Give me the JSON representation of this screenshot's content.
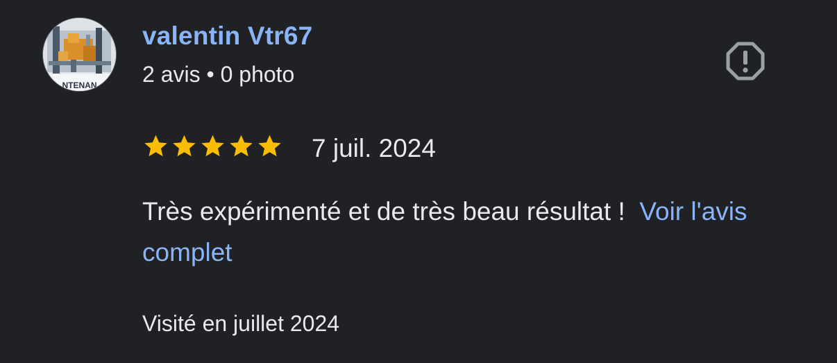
{
  "review": {
    "author": {
      "name": "valentin Vtr67",
      "stats": "2 avis • 0 photo",
      "avatar_caption": "NTENAN"
    },
    "rating": 5,
    "rating_max": 5,
    "date": "7 juil. 2024",
    "text": "Très expérimenté et de très beau résultat !",
    "more_link": "Voir l'avis complet",
    "visit_info": "Visité en juillet 2024"
  },
  "icons": {
    "report": "report-flag-icon",
    "star": "star-icon"
  },
  "colors": {
    "background": "#202124",
    "text": "#e8eaed",
    "link": "#8ab4f8",
    "star": "#fbbc04",
    "icon": "#9aa0a6"
  }
}
